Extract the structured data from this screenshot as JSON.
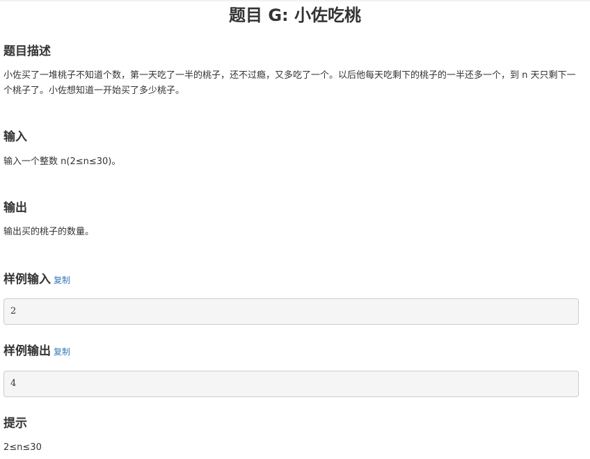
{
  "title": "题目 G: 小佐吃桃",
  "description": {
    "heading": "题目描述",
    "text": "小佐买了一堆桃子不知道个数，第一天吃了一半的桃子，还不过瘾，又多吃了一个。以后他每天吃剩下的桃子的一半还多一个，到 n 天只剩下一个桃子了。小佐想知道一开始买了多少桃子。"
  },
  "input": {
    "heading": "输入",
    "text": "输入一个整数 n(2≤n≤30)。"
  },
  "output": {
    "heading": "输出",
    "text": "输出买的桃子的数量。"
  },
  "sample_input": {
    "heading": "样例输入",
    "copy_label": "复制",
    "value": "2"
  },
  "sample_output": {
    "heading": "样例输出",
    "copy_label": "复制",
    "value": "4"
  },
  "hint": {
    "heading": "提示",
    "text": "2≤n≤30"
  },
  "colors": {
    "text": "#333333",
    "link": "#337ab7",
    "sample_bg": "#f5f5f5",
    "sample_border": "#cccccc"
  }
}
